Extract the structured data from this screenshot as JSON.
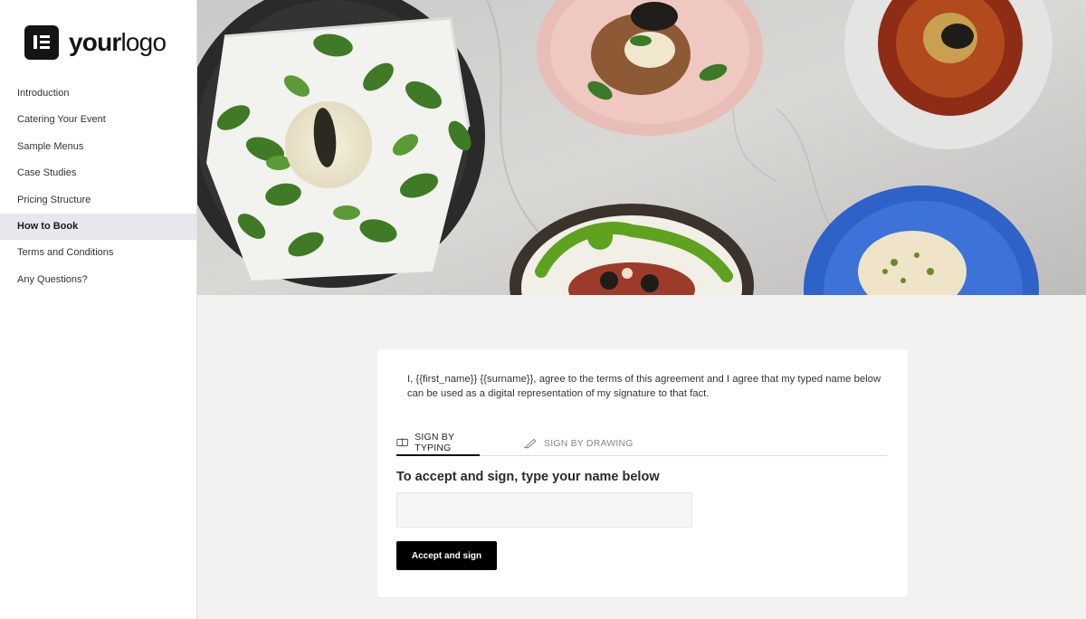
{
  "logo": {
    "text_bold": "your",
    "text_regular": "logo"
  },
  "sidebar": {
    "items": [
      {
        "label": "Introduction"
      },
      {
        "label": "Catering Your Event"
      },
      {
        "label": "Sample Menus"
      },
      {
        "label": "Case Studies"
      },
      {
        "label": "Pricing Structure"
      },
      {
        "label": "How to Book",
        "active": true
      },
      {
        "label": "Terms and Conditions"
      },
      {
        "label": "Any Questions?"
      }
    ]
  },
  "signing": {
    "agreement_text": "I, {{first_name}} {{surname}}, agree to the terms of this agreement and I agree that my typed name below can be used as a digital representation of my signature to that fact.",
    "tabs": [
      {
        "label": "SIGN BY TYPING",
        "active": true,
        "icon": "keyboard-icon"
      },
      {
        "label": "SIGN BY DRAWING",
        "active": false,
        "icon": "pen-icon"
      }
    ],
    "heading": "To accept and sign, type your name below",
    "name_input_value": "",
    "name_input_placeholder": "",
    "accept_button_label": "Accept and sign"
  },
  "colors": {
    "sidebar_bg": "#ffffff",
    "active_item_bg": "#e8e8ec",
    "page_bg": "#f2f2f0",
    "button_bg": "#000000"
  }
}
